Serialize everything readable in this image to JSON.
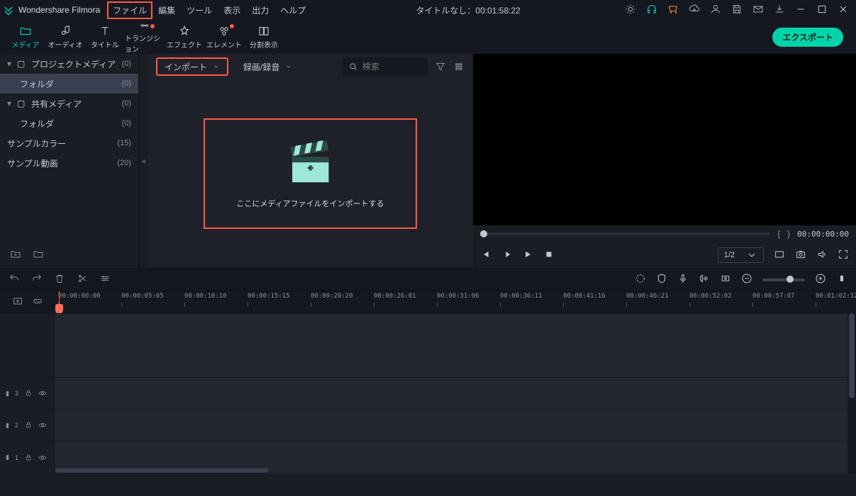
{
  "app_name": "Wondershare Filmora",
  "menu": {
    "file": "ファイル",
    "edit": "編集",
    "tool": "ツール",
    "view": "表示",
    "output": "出力",
    "help": "ヘルプ"
  },
  "title_status": "タイトルなし：00:01:58:22",
  "tabs": {
    "media": "メディア",
    "audio": "オーディオ",
    "title": "タイトル",
    "transition": "トランジション",
    "effect": "エフェクト",
    "element": "エレメント",
    "split": "分割表示"
  },
  "export_label": "エクスポート",
  "sidebar": {
    "project_media": "プロジェクトメディア",
    "project_media_cnt": "(0)",
    "folder": "フォルダ",
    "folder_cnt": "(0)",
    "shared_media": "共有メディア",
    "shared_media_cnt": "(0)",
    "folder2": "フォルダ",
    "folder2_cnt": "(0)",
    "sample_color": "サンプルカラー",
    "sample_color_cnt": "(15)",
    "sample_video": "サンプル動画",
    "sample_video_cnt": "(20)"
  },
  "media_bar": {
    "import": "インポート",
    "record": "録画/録音",
    "search_ph": "検索"
  },
  "drop_text": "ここにメディアファイルをインポートする",
  "preview": {
    "tc": "00:00:00:00",
    "zoom": "1/2"
  },
  "ruler_ticks": [
    "00:00:00:00",
    "00:00:05:05",
    "00:00:10:10",
    "00:00:15:15",
    "00:00:20:20",
    "00:00:26:01",
    "00:00:31:06",
    "00:00:36:11",
    "00:00:41:16",
    "00:00:46:21",
    "00:00:52:02",
    "00:00:57:07",
    "00:01:02:12"
  ],
  "tracks": {
    "t3_label": "3",
    "t2_label": "2",
    "t1_label": "1"
  },
  "marker_glyph": "▮"
}
